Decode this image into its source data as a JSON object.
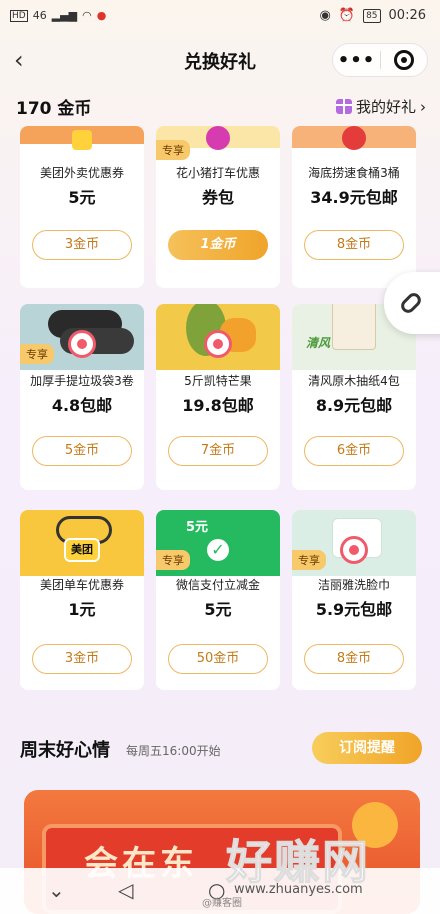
{
  "status_bar": {
    "left_text": "46",
    "battery": "85",
    "time": "00:26"
  },
  "nav": {
    "title": "兑换好礼",
    "more": "•••"
  },
  "coins": {
    "count": "170 金币",
    "my_gifts": "我的好礼"
  },
  "cards": [
    {
      "title": "美团外卖优惠券",
      "price": "5元",
      "button": "3金币",
      "special": ""
    },
    {
      "title": "花小猪打车优惠",
      "price": "券包",
      "button": "1金币",
      "special": "专享"
    },
    {
      "title": "海底捞速食桶3桶",
      "price": "34.9元包邮",
      "button": "8金币",
      "special": ""
    },
    {
      "title": "加厚手提垃圾袋3卷",
      "price": "4.8包邮",
      "button": "5金币",
      "special": "专享"
    },
    {
      "title": "5斤凯特芒果",
      "price": "19.8包邮",
      "button": "7金币",
      "special": ""
    },
    {
      "title": "清风原木抽纸4包",
      "price": "8.9元包邮",
      "button": "6金币",
      "special": ""
    },
    {
      "title": "美团单车优惠券",
      "price": "1元",
      "button": "3金币",
      "special": ""
    },
    {
      "title": "微信支付立减金",
      "price": "5元",
      "button": "50金币",
      "special": "专享"
    },
    {
      "title": "洁丽雅洗脸巾",
      "price": "5.9元包邮",
      "button": "8金币",
      "special": "专享"
    }
  ],
  "image_labels": {
    "meituan": "美团",
    "wechat_amount": "5元",
    "qingfeng": "清风"
  },
  "weekend": {
    "title": "周末好心情",
    "subtitle": "每周五16:00开始",
    "subscribe": "订阅提醒"
  },
  "banner": {
    "text": "会在东"
  },
  "watermark": {
    "brand": "好赚网",
    "url": "www.zhuanyes.com",
    "weibo": "@赚客圈"
  },
  "colors": {
    "accent_gold": "#f0a42a",
    "button_border": "#efb864",
    "brand_red": "#f05a6a"
  }
}
